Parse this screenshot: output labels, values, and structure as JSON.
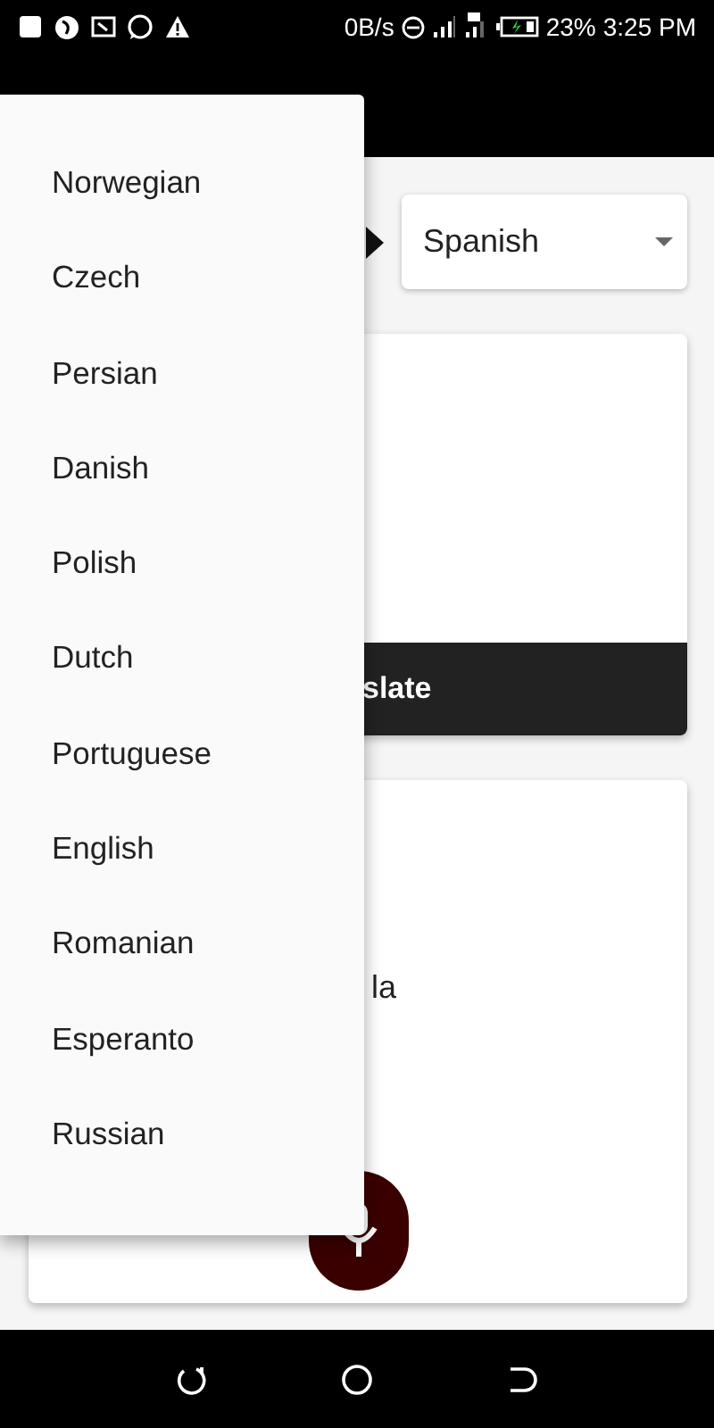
{
  "status_bar": {
    "net_speed": "0B/s",
    "battery": "23%",
    "time": "3:25 PM"
  },
  "target_language": {
    "value": "Spanish"
  },
  "translate_button": {
    "label": "slate"
  },
  "output_card": {
    "text": "la"
  },
  "language_menu": {
    "items": [
      "Norwegian",
      "Czech",
      "Persian",
      "Danish",
      "Polish",
      "Dutch",
      "Portuguese",
      "English",
      "Romanian",
      "Esperanto",
      "Russian"
    ]
  }
}
